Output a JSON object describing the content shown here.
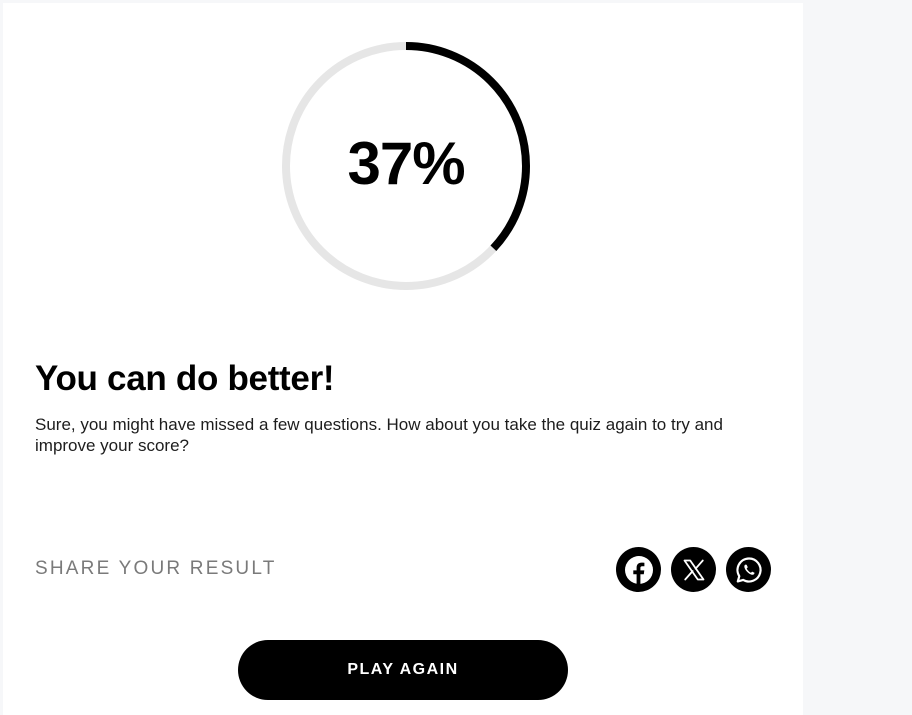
{
  "result": {
    "score_text": "37%",
    "score_fraction": 0.37,
    "title": "You can do better!",
    "description": "Sure, you might have missed a few questions. How about you take the quiz again to try and improve your score?"
  },
  "share": {
    "label": "SHARE YOUR RESULT",
    "buttons": [
      {
        "icon": "facebook-icon"
      },
      {
        "icon": "x-icon"
      },
      {
        "icon": "whatsapp-icon"
      }
    ]
  },
  "actions": {
    "play_again_label": "PLAY AGAIN"
  },
  "colors": {
    "ring_track": "#e6e6e6",
    "ring_progress": "#000000",
    "button_bg": "#000000",
    "button_text": "#ffffff",
    "share_label": "#7a7a7a",
    "page_bg": "#f6f7f9"
  }
}
